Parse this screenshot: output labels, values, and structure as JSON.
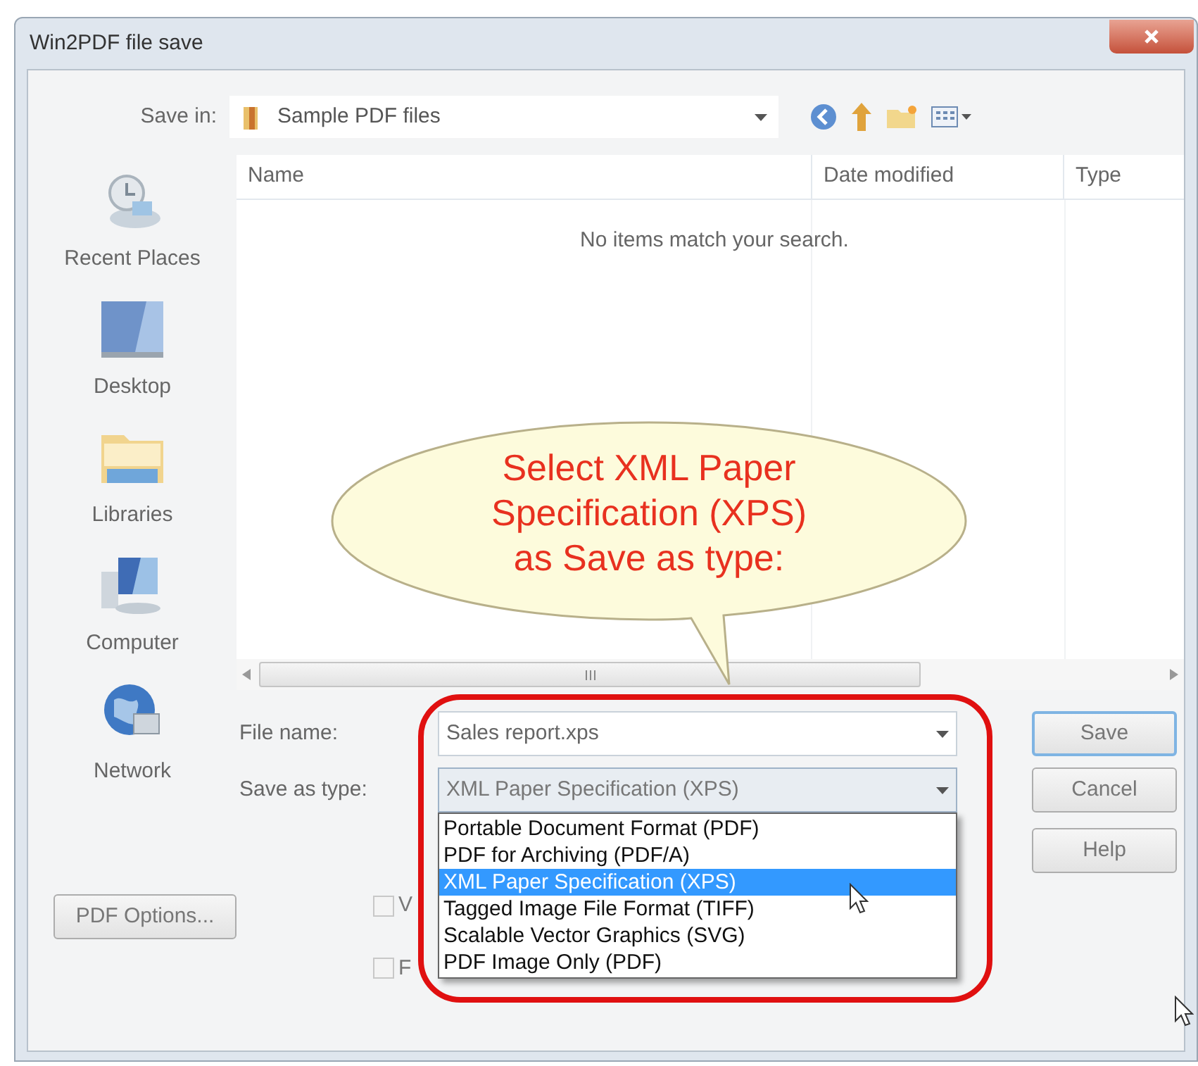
{
  "window": {
    "title": "Win2PDF file save"
  },
  "save_in": {
    "label": "Save in:",
    "value": "Sample PDF files"
  },
  "places": [
    {
      "label": "Recent Places",
      "kind": "recent"
    },
    {
      "label": "Desktop",
      "kind": "desktop"
    },
    {
      "label": "Libraries",
      "kind": "libraries"
    },
    {
      "label": "Computer",
      "kind": "computer"
    },
    {
      "label": "Network",
      "kind": "network"
    }
  ],
  "file_list": {
    "columns": [
      "Name",
      "Date modified",
      "Type"
    ],
    "empty_message": "No items match your search."
  },
  "file_name": {
    "label": "File name:",
    "value": "Sales report.xps"
  },
  "save_as_type": {
    "label": "Save as type:",
    "value": "XML Paper Specification (XPS)",
    "expanded": true,
    "options": [
      {
        "label": "Portable Document Format (PDF)",
        "selected": false
      },
      {
        "label": "PDF for Archiving (PDF/A)",
        "selected": false
      },
      {
        "label": "XML Paper Specification (XPS)",
        "selected": true
      },
      {
        "label": "Tagged Image File Format (TIFF)",
        "selected": false
      },
      {
        "label": "Scalable Vector Graphics (SVG)",
        "selected": false
      },
      {
        "label": "PDF Image Only (PDF)",
        "selected": false
      }
    ]
  },
  "buttons": [
    {
      "label": "Save",
      "default": true
    },
    {
      "label": "Cancel",
      "default": false
    },
    {
      "label": "Help",
      "default": false
    }
  ],
  "pdf_options_button": "PDF Options...",
  "checkboxes": [
    {
      "label": "V",
      "checked": false
    },
    {
      "label": "F",
      "checked": false
    }
  ],
  "callout": {
    "text_lines": [
      "Select XML Paper",
      "Specification (XPS)",
      "as Save as type:"
    ]
  }
}
